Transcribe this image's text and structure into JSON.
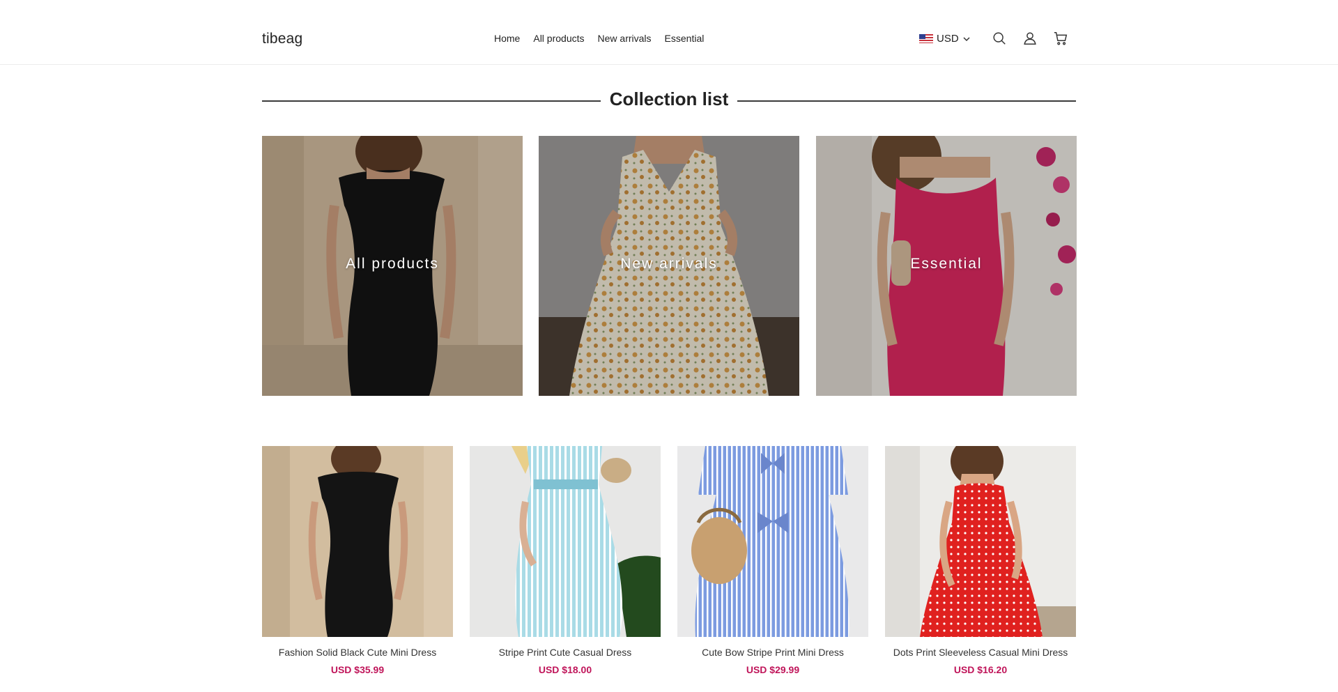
{
  "header": {
    "logo": "tibeag",
    "nav": [
      "Home",
      "All products",
      "New arrivals",
      "Essential"
    ],
    "currency": "USD",
    "icons": [
      "us-flag-icon",
      "chevron-down-icon",
      "search-icon",
      "user-icon",
      "cart-icon"
    ]
  },
  "collection": {
    "title": "Collection list",
    "tiles": [
      {
        "label": "All products"
      },
      {
        "label": "New arrivals"
      },
      {
        "label": "Essential"
      }
    ]
  },
  "products": [
    {
      "name": "Fashion Solid Black Cute Mini Dress",
      "price": "USD $35.99"
    },
    {
      "name": "Stripe Print Cute Casual Dress",
      "price": "USD $18.00"
    },
    {
      "name": "Cute Bow Stripe Print Mini Dress",
      "price": "USD $29.99"
    },
    {
      "name": "Dots Print Sleeveless Casual Mini Dress",
      "price": "USD $16.20"
    }
  ],
  "colors": {
    "price": "#c0155a",
    "text": "#222222",
    "divider": "#3a3a3a"
  }
}
